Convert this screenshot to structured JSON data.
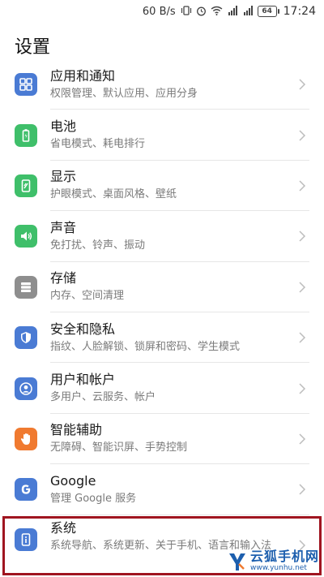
{
  "statusbar": {
    "speed": "60 B/s",
    "battery": "64",
    "time": "17:24",
    "icons": [
      "vibrate-icon",
      "alarm-icon",
      "wifi-icon",
      "signal-4g-icon",
      "signal-icon"
    ]
  },
  "page": {
    "title": "设置"
  },
  "items": [
    {
      "name": "apps-notifications",
      "title": "应用和通知",
      "sub": "权限管理、默认应用、应用分身",
      "icon": "apps-grid-icon",
      "color": "#4a7bd4"
    },
    {
      "name": "battery",
      "title": "电池",
      "sub": "省电模式、耗电排行",
      "icon": "battery-icon",
      "color": "#3fbf6a"
    },
    {
      "name": "display",
      "title": "显示",
      "sub": "护眼模式、桌面风格、壁纸",
      "icon": "display-icon",
      "color": "#3fbf6a"
    },
    {
      "name": "sound",
      "title": "声音",
      "sub": "免打扰、铃声、振动",
      "icon": "speaker-icon",
      "color": "#3fbf6a"
    },
    {
      "name": "storage",
      "title": "存储",
      "sub": "内存、空间清理",
      "icon": "storage-icon",
      "color": "#8e8e8e"
    },
    {
      "name": "security-privacy",
      "title": "安全和隐私",
      "sub": "指纹、人脸解锁、锁屏和密码、学生模式",
      "icon": "shield-icon",
      "color": "#4a7bd4"
    },
    {
      "name": "users-accounts",
      "title": "用户和帐户",
      "sub": "多用户、云服务、帐户",
      "icon": "user-icon",
      "color": "#4a7bd4"
    },
    {
      "name": "accessibility",
      "title": "智能辅助",
      "sub": "无障碍、智能识屏、手势控制",
      "icon": "hand-icon",
      "color": "#f07a30"
    },
    {
      "name": "google",
      "title": "Google",
      "sub": "管理 Google 服务",
      "icon": "google-icon",
      "color": "#4a7bd4"
    },
    {
      "name": "system",
      "title": "系统",
      "sub": "系统导航、系统更新、关于手机、语言和输入法",
      "icon": "info-icon",
      "color": "#4a7bd4"
    }
  ],
  "watermark": {
    "brand": "云狐手机网",
    "url": "www.yunhu.net"
  }
}
